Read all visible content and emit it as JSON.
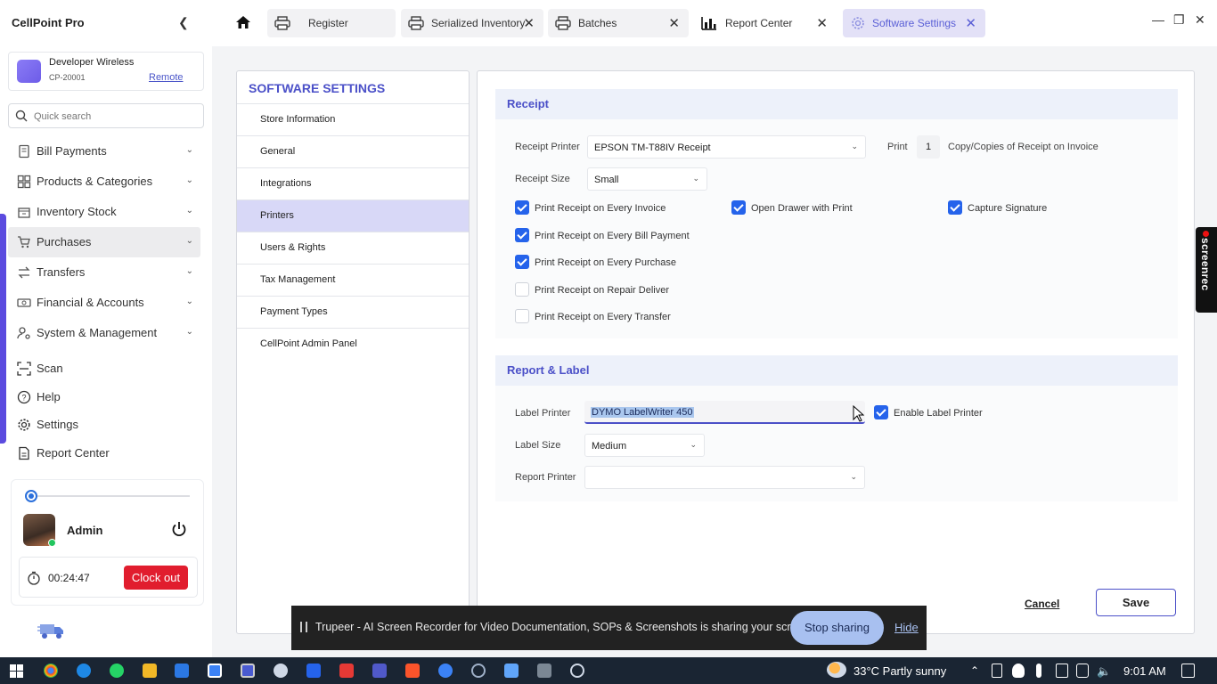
{
  "app": {
    "title": "CellPoint Pro"
  },
  "account": {
    "name": "Developer Wireless",
    "code": "CP-20001",
    "link": "Remote"
  },
  "search": {
    "placeholder": "Quick search"
  },
  "nav": [
    {
      "label": "Bill Payments",
      "icon": "receipt-icon"
    },
    {
      "label": "Products & Categories",
      "icon": "grid-icon"
    },
    {
      "label": "Inventory Stock",
      "icon": "box-icon"
    },
    {
      "label": "Purchases",
      "icon": "cart-icon"
    },
    {
      "label": "Transfers",
      "icon": "transfer-icon"
    },
    {
      "label": "Financial & Accounts",
      "icon": "money-icon"
    },
    {
      "label": "System & Management",
      "icon": "person-gear-icon"
    }
  ],
  "nav2": [
    {
      "label": "Scan",
      "icon": "scan-icon"
    },
    {
      "label": "Help",
      "icon": "help-icon"
    },
    {
      "label": "Settings",
      "icon": "gear-icon"
    },
    {
      "label": "Report Center",
      "icon": "document-icon"
    }
  ],
  "user": {
    "name": "Admin",
    "timer": "00:24:47",
    "clockout": "Clock out"
  },
  "tabs": [
    {
      "label": "Register",
      "icon": "printer-icon"
    },
    {
      "label": "Serialized Inventory",
      "icon": "printer-icon"
    },
    {
      "label": "Batches",
      "icon": "printer-icon"
    },
    {
      "label": "Report Center",
      "icon": "bar-chart-icon"
    },
    {
      "label": "Software Settings",
      "icon": "gear-icon"
    }
  ],
  "settings": {
    "title": "SOFTWARE SETTINGS",
    "menu": [
      "Store Information",
      "General",
      "Integrations",
      "Printers",
      "Users & Rights",
      "Tax Management",
      "Payment Types",
      "CellPoint Admin Panel"
    ],
    "active": "Printers"
  },
  "receipt": {
    "heading": "Receipt",
    "printer_label": "Receipt Printer",
    "printer_value": "EPSON TM-T88IV Receipt",
    "print_label": "Print",
    "copies": "1",
    "copies_suffix": "Copy/Copies of Receipt on Invoice",
    "size_label": "Receipt Size",
    "size_value": "Small",
    "options": [
      {
        "label": "Print Receipt on Every Invoice",
        "checked": true
      },
      {
        "label": "Open Drawer with Print",
        "checked": true
      },
      {
        "label": "Capture Signature",
        "checked": true
      },
      {
        "label": "Print Receipt on Every Bill Payment",
        "checked": true
      },
      {
        "label": "Print Receipt on Every Purchase",
        "checked": true
      },
      {
        "label": "Print Receipt on Repair Deliver",
        "checked": false
      },
      {
        "label": "Print Receipt on Every Transfer",
        "checked": false
      }
    ]
  },
  "report_label": {
    "heading": "Report & Label",
    "label_printer_label": "Label Printer",
    "label_printer_value": "DYMO LabelWriter 450",
    "enable_label": "Enable Label Printer",
    "enable_checked": true,
    "label_size_label": "Label Size",
    "label_size_value": "Medium",
    "report_printer_label": "Report Printer",
    "report_printer_value": ""
  },
  "actions": {
    "cancel": "Cancel",
    "save": "Save"
  },
  "screenrec": {
    "label": "screenrec"
  },
  "sharing": {
    "message": "Trupeer - AI Screen Recorder for Video Documentation, SOPs & Screenshots is sharing your screen.",
    "stop": "Stop sharing",
    "hide": "Hide"
  },
  "taskbar": {
    "weather": "33°C  Partly sunny",
    "time": "9:01 AM"
  },
  "colors": {
    "accent": "#4b50c8",
    "danger": "#e11d2e",
    "checkbox": "#2563eb",
    "active_tab": "#e3e1f7"
  }
}
